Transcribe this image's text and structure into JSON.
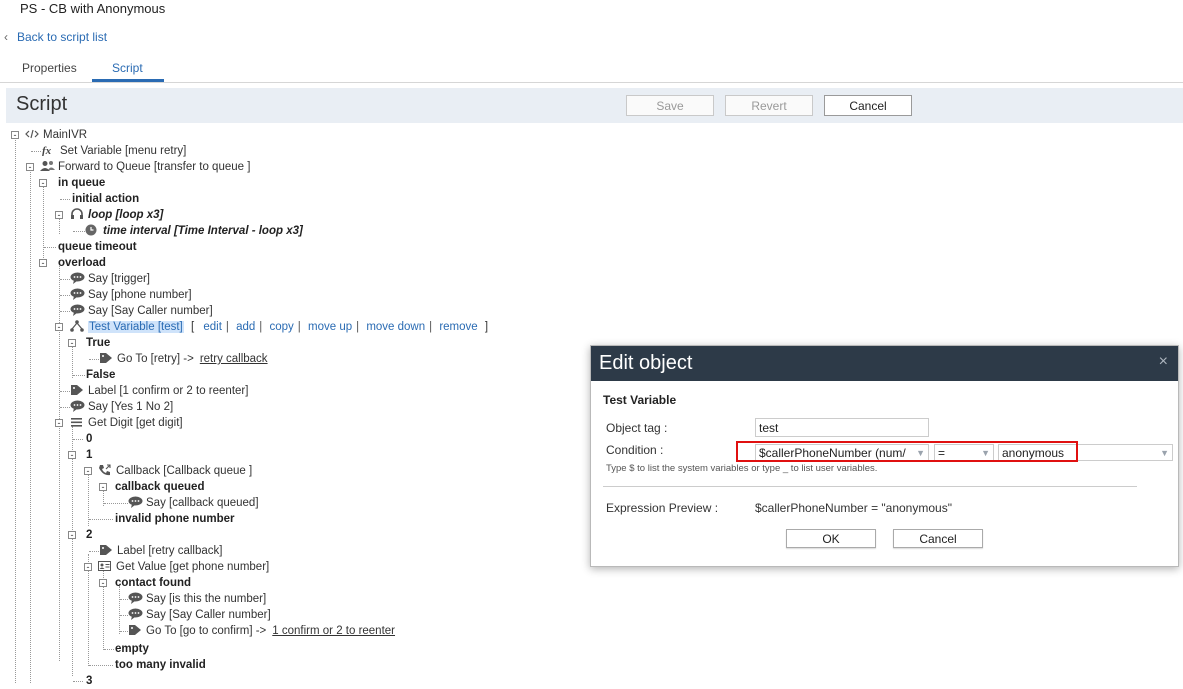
{
  "page": {
    "title": "PS - CB with Anonymous",
    "back_label": "Back to script list"
  },
  "tabs": [
    {
      "label": "Properties"
    },
    {
      "label": "Script",
      "active": true
    }
  ],
  "toolbar": {
    "title": "Script",
    "save_label": "Save",
    "revert_label": "Revert",
    "cancel_label": "Cancel"
  },
  "tree": {
    "root": "MainIVR",
    "set_variable": "Set Variable [menu retry]",
    "forward_queue": "Forward to Queue [transfer to queue ]",
    "in_queue": "in queue",
    "initial_action": "initial action",
    "loop": "loop [loop x3]",
    "time_interval": "time interval [Time Interval - loop x3]",
    "queue_timeout": "queue timeout",
    "overload": "overload",
    "say_trigger": "Say [trigger]",
    "say_phone": "Say [phone number]",
    "say_caller": "Say [Say Caller number]",
    "test_variable": "Test Variable [test]",
    "actions": {
      "open": "[",
      "edit": "edit",
      "add": "add",
      "copy": "copy",
      "move_up": "move up",
      "move_down": "move down",
      "remove": "remove",
      "close": "]",
      "sep": "|"
    },
    "true_label": "True",
    "goto_retry": "Go To [retry] ->",
    "goto_retry_link": "retry callback",
    "false_label": "False",
    "label_confirm": "Label [1 confirm or 2 to reenter]",
    "say_yes": "Say [Yes 1 No 2]",
    "get_digit": "Get Digit [get digit]",
    "digit_0": "0",
    "digit_1": "1",
    "callback": "Callback [Callback queue ]",
    "callback_queued": "callback queued",
    "say_cb_queued": "Say [callback queued]",
    "invalid_phone": "invalid phone number",
    "digit_2": "2",
    "label_retry": "Label [retry callback]",
    "get_value": "Get Value [get phone number]",
    "contact_found": "contact found",
    "say_is_number": "Say [is this the number]",
    "say_caller2": "Say [Say Caller number]",
    "goto_confirm": "Go To [go to confirm] ->",
    "goto_confirm_link": "1 confirm or 2 to reenter",
    "empty": "empty",
    "too_many_invalid": "too many invalid",
    "digit_3": "3"
  },
  "modal": {
    "title": "Edit object",
    "close": "×",
    "subtitle": "Test Variable",
    "object_tag_label": "Object tag :",
    "object_tag_value": "test",
    "condition_label": "Condition :",
    "condition_variable": "$callerPhoneNumber (num/",
    "condition_operator": "=",
    "condition_value": "anonymous",
    "hint": "Type $ to list the system variables or type _ to list user variables.",
    "preview_label": "Expression Preview :",
    "preview_value": "$callerPhoneNumber = \"anonymous\"",
    "ok_label": "OK",
    "cancel_label": "Cancel"
  },
  "colors": {
    "accent": "#2a6bb3",
    "modal_header": "#2d3a48",
    "highlight": "#e01010"
  }
}
